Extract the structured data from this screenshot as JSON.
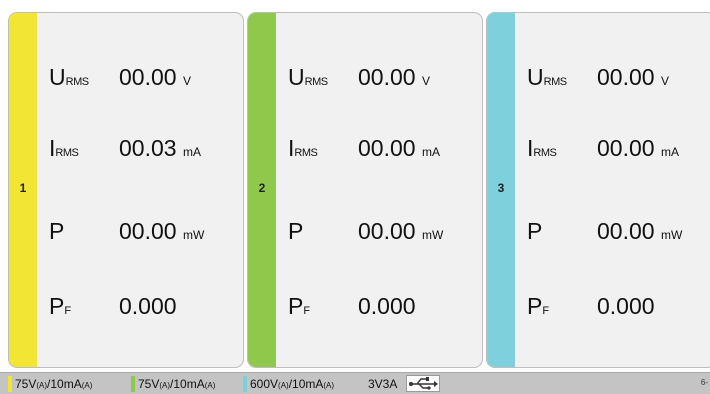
{
  "colors": {
    "ch1": "#f3e534",
    "ch2": "#8fc84a",
    "ch3": "#7ed0dd"
  },
  "channels": [
    {
      "number": "1",
      "urms": {
        "symbol": "U",
        "sub": "RMS",
        "value": "00.00",
        "unit": "V"
      },
      "irms": {
        "symbol": "I",
        "sub": "RMS",
        "value": "00.03",
        "unit": "mA"
      },
      "p": {
        "symbol": "P",
        "value": "00.00",
        "unit": "mW"
      },
      "pf": {
        "symbol": "P",
        "sub": "F",
        "value": "0.000"
      }
    },
    {
      "number": "2",
      "urms": {
        "symbol": "U",
        "sub": "RMS",
        "value": "00.00",
        "unit": "V"
      },
      "irms": {
        "symbol": "I",
        "sub": "RMS",
        "value": "00.00",
        "unit": "mA"
      },
      "p": {
        "symbol": "P",
        "value": "00.00",
        "unit": "mW"
      },
      "pf": {
        "symbol": "P",
        "sub": "F",
        "value": "0.000"
      }
    },
    {
      "number": "3",
      "urms": {
        "symbol": "U",
        "sub": "RMS",
        "value": "00.00",
        "unit": "V"
      },
      "irms": {
        "symbol": "I",
        "sub": "RMS",
        "value": "00.00",
        "unit": "mA"
      },
      "p": {
        "symbol": "P",
        "value": "00.00",
        "unit": "mW"
      },
      "pf": {
        "symbol": "P",
        "sub": "F",
        "value": "0.000"
      }
    }
  ],
  "status": {
    "ranges": [
      {
        "v": "75V",
        "vsub": "(A)",
        "i": "/10mA",
        "isub": "(A)"
      },
      {
        "v": "75V",
        "vsub": "(A)",
        "i": "/10mA",
        "isub": "(A)"
      },
      {
        "v": "600V",
        "vsub": "(A)",
        "i": "/10mA",
        "isub": "(A)"
      }
    ],
    "supply": "3V3A",
    "usb_icon": "usb-icon",
    "page": "6-"
  }
}
